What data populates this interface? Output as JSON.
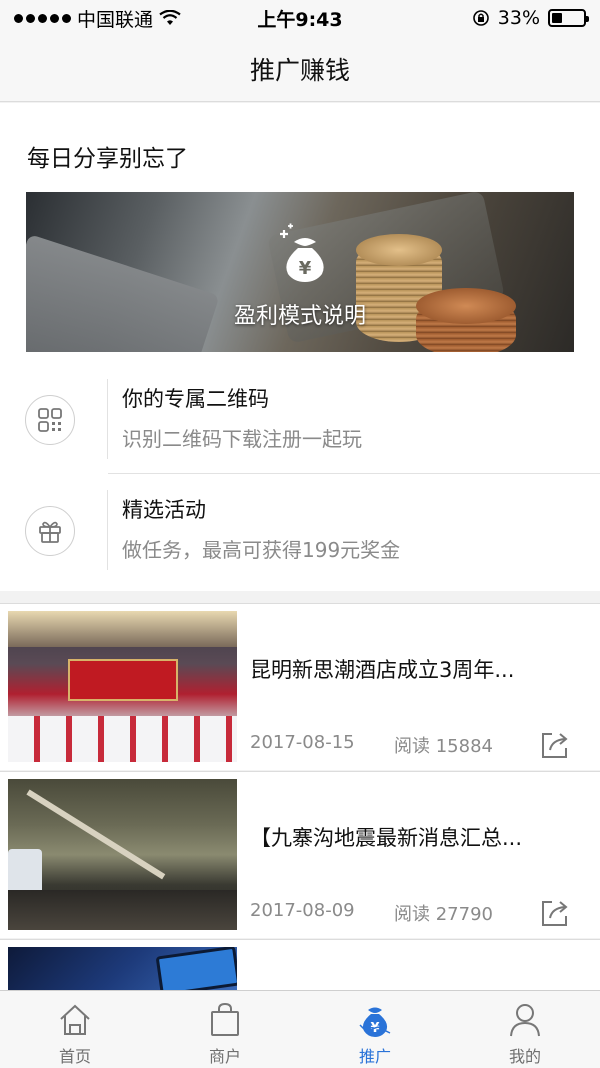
{
  "status_bar": {
    "carrier": "中国联通",
    "time": "上午9:43",
    "battery": "33%",
    "battery_level": 0.33
  },
  "nav": {
    "title": "推广赚钱"
  },
  "promo": {
    "heading": "每日分享别忘了",
    "banner_label": "盈利模式说明",
    "items": [
      {
        "title": "你的专属二维码",
        "subtitle": "识别二维码下载注册一起玩",
        "icon": "qrcode-icon"
      },
      {
        "title": "精选活动",
        "subtitle": "做任务，最高可获得199元奖金",
        "icon": "gift-icon"
      }
    ]
  },
  "news": [
    {
      "title": "昆明新思潮酒店成立3周年...",
      "date": "2017-08-15",
      "reads": "阅读 15884"
    },
    {
      "title": "【九寨沟地震最新消息汇总...",
      "date": "2017-08-09",
      "reads": "阅读 27790"
    }
  ],
  "tabs": [
    {
      "label": "首页",
      "icon": "home-icon",
      "active": false
    },
    {
      "label": "商户",
      "icon": "shopping-bag-icon",
      "active": false
    },
    {
      "label": "推广",
      "icon": "money-bag-icon",
      "active": true
    },
    {
      "label": "我的",
      "icon": "person-icon",
      "active": false
    }
  ],
  "colors": {
    "accent": "#2a73d8",
    "text_secondary": "#8a8a8a"
  }
}
